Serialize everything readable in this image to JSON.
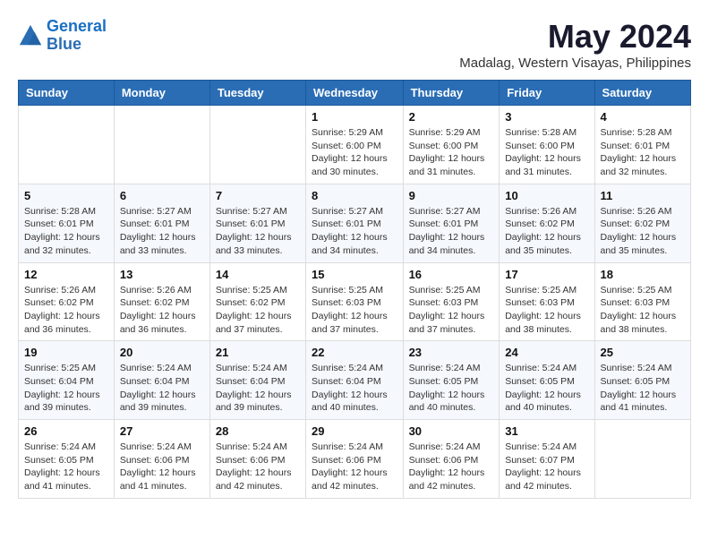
{
  "header": {
    "logo_line1": "General",
    "logo_line2": "Blue",
    "month": "May 2024",
    "location": "Madalag, Western Visayas, Philippines"
  },
  "days_of_week": [
    "Sunday",
    "Monday",
    "Tuesday",
    "Wednesday",
    "Thursday",
    "Friday",
    "Saturday"
  ],
  "weeks": [
    [
      {
        "day": "",
        "info": ""
      },
      {
        "day": "",
        "info": ""
      },
      {
        "day": "",
        "info": ""
      },
      {
        "day": "1",
        "info": "Sunrise: 5:29 AM\nSunset: 6:00 PM\nDaylight: 12 hours\nand 30 minutes."
      },
      {
        "day": "2",
        "info": "Sunrise: 5:29 AM\nSunset: 6:00 PM\nDaylight: 12 hours\nand 31 minutes."
      },
      {
        "day": "3",
        "info": "Sunrise: 5:28 AM\nSunset: 6:00 PM\nDaylight: 12 hours\nand 31 minutes."
      },
      {
        "day": "4",
        "info": "Sunrise: 5:28 AM\nSunset: 6:01 PM\nDaylight: 12 hours\nand 32 minutes."
      }
    ],
    [
      {
        "day": "5",
        "info": "Sunrise: 5:28 AM\nSunset: 6:01 PM\nDaylight: 12 hours\nand 32 minutes."
      },
      {
        "day": "6",
        "info": "Sunrise: 5:27 AM\nSunset: 6:01 PM\nDaylight: 12 hours\nand 33 minutes."
      },
      {
        "day": "7",
        "info": "Sunrise: 5:27 AM\nSunset: 6:01 PM\nDaylight: 12 hours\nand 33 minutes."
      },
      {
        "day": "8",
        "info": "Sunrise: 5:27 AM\nSunset: 6:01 PM\nDaylight: 12 hours\nand 34 minutes."
      },
      {
        "day": "9",
        "info": "Sunrise: 5:27 AM\nSunset: 6:01 PM\nDaylight: 12 hours\nand 34 minutes."
      },
      {
        "day": "10",
        "info": "Sunrise: 5:26 AM\nSunset: 6:02 PM\nDaylight: 12 hours\nand 35 minutes."
      },
      {
        "day": "11",
        "info": "Sunrise: 5:26 AM\nSunset: 6:02 PM\nDaylight: 12 hours\nand 35 minutes."
      }
    ],
    [
      {
        "day": "12",
        "info": "Sunrise: 5:26 AM\nSunset: 6:02 PM\nDaylight: 12 hours\nand 36 minutes."
      },
      {
        "day": "13",
        "info": "Sunrise: 5:26 AM\nSunset: 6:02 PM\nDaylight: 12 hours\nand 36 minutes."
      },
      {
        "day": "14",
        "info": "Sunrise: 5:25 AM\nSunset: 6:02 PM\nDaylight: 12 hours\nand 37 minutes."
      },
      {
        "day": "15",
        "info": "Sunrise: 5:25 AM\nSunset: 6:03 PM\nDaylight: 12 hours\nand 37 minutes."
      },
      {
        "day": "16",
        "info": "Sunrise: 5:25 AM\nSunset: 6:03 PM\nDaylight: 12 hours\nand 37 minutes."
      },
      {
        "day": "17",
        "info": "Sunrise: 5:25 AM\nSunset: 6:03 PM\nDaylight: 12 hours\nand 38 minutes."
      },
      {
        "day": "18",
        "info": "Sunrise: 5:25 AM\nSunset: 6:03 PM\nDaylight: 12 hours\nand 38 minutes."
      }
    ],
    [
      {
        "day": "19",
        "info": "Sunrise: 5:25 AM\nSunset: 6:04 PM\nDaylight: 12 hours\nand 39 minutes."
      },
      {
        "day": "20",
        "info": "Sunrise: 5:24 AM\nSunset: 6:04 PM\nDaylight: 12 hours\nand 39 minutes."
      },
      {
        "day": "21",
        "info": "Sunrise: 5:24 AM\nSunset: 6:04 PM\nDaylight: 12 hours\nand 39 minutes."
      },
      {
        "day": "22",
        "info": "Sunrise: 5:24 AM\nSunset: 6:04 PM\nDaylight: 12 hours\nand 40 minutes."
      },
      {
        "day": "23",
        "info": "Sunrise: 5:24 AM\nSunset: 6:05 PM\nDaylight: 12 hours\nand 40 minutes."
      },
      {
        "day": "24",
        "info": "Sunrise: 5:24 AM\nSunset: 6:05 PM\nDaylight: 12 hours\nand 40 minutes."
      },
      {
        "day": "25",
        "info": "Sunrise: 5:24 AM\nSunset: 6:05 PM\nDaylight: 12 hours\nand 41 minutes."
      }
    ],
    [
      {
        "day": "26",
        "info": "Sunrise: 5:24 AM\nSunset: 6:05 PM\nDaylight: 12 hours\nand 41 minutes."
      },
      {
        "day": "27",
        "info": "Sunrise: 5:24 AM\nSunset: 6:06 PM\nDaylight: 12 hours\nand 41 minutes."
      },
      {
        "day": "28",
        "info": "Sunrise: 5:24 AM\nSunset: 6:06 PM\nDaylight: 12 hours\nand 42 minutes."
      },
      {
        "day": "29",
        "info": "Sunrise: 5:24 AM\nSunset: 6:06 PM\nDaylight: 12 hours\nand 42 minutes."
      },
      {
        "day": "30",
        "info": "Sunrise: 5:24 AM\nSunset: 6:06 PM\nDaylight: 12 hours\nand 42 minutes."
      },
      {
        "day": "31",
        "info": "Sunrise: 5:24 AM\nSunset: 6:07 PM\nDaylight: 12 hours\nand 42 minutes."
      },
      {
        "day": "",
        "info": ""
      }
    ]
  ]
}
